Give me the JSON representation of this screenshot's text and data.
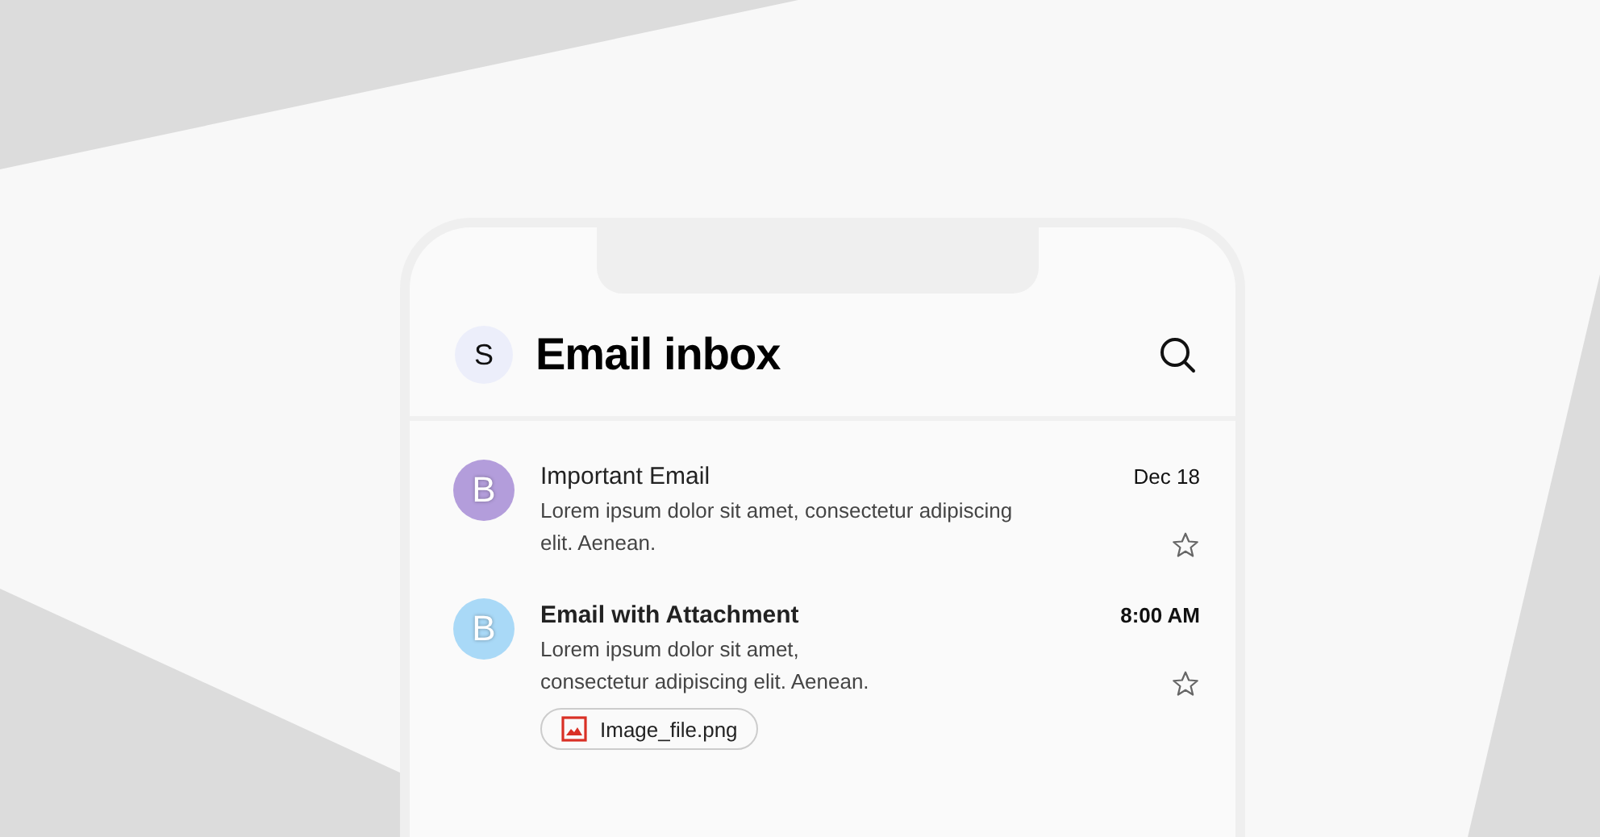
{
  "header": {
    "avatar_letter": "S",
    "title": "Email inbox"
  },
  "emails": [
    {
      "avatar_letter": "B",
      "color": "#b39ddb",
      "sender": "Important Email",
      "preview": "Lorem ipsum dolor sit amet, consectetur adipiscing elit. Aenean.",
      "time": "Dec 18",
      "unread": false,
      "starred": false
    },
    {
      "avatar_letter": "B",
      "color": "#a9d9f7",
      "sender": "Email with Attachment",
      "preview": "Lorem ipsum dolor sit amet, consectetur adipiscing elit. Aenean.",
      "time": "8:00 AM",
      "unread": true,
      "starred": false,
      "attachment": "Image_file.png"
    }
  ]
}
